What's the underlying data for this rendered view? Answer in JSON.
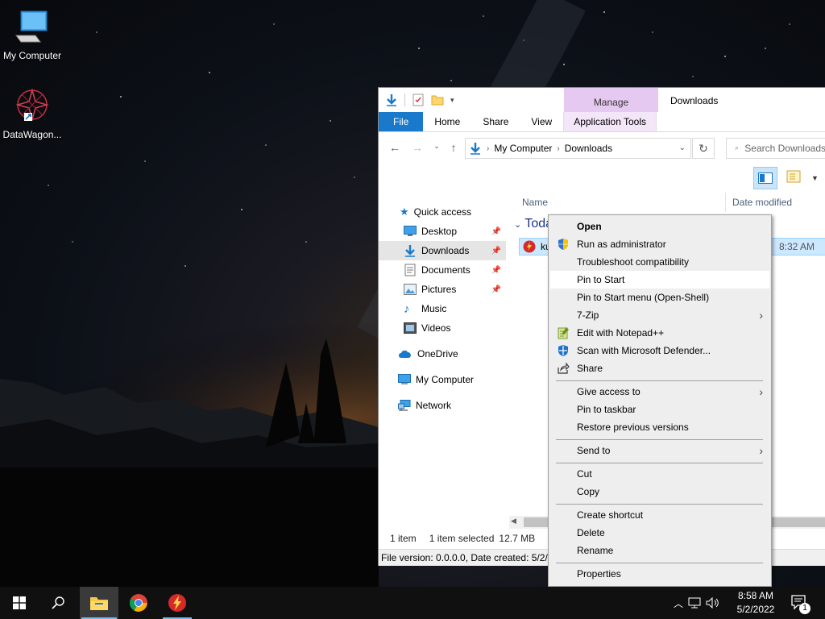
{
  "desktop": {
    "icons": [
      {
        "label": "My Computer",
        "icon": "monitor-icon"
      },
      {
        "label": "DataWagon...",
        "icon": "datawagon-app-icon"
      }
    ]
  },
  "explorer": {
    "window_title": "Downloads",
    "contextual_tab_header": "Manage",
    "ribbon_tabs": [
      "File",
      "Home",
      "Share",
      "View",
      "Application Tools"
    ],
    "address": {
      "crumbs": [
        "My Computer",
        "Downloads"
      ]
    },
    "search_placeholder": "Search Downloads",
    "nav_pane": {
      "items": [
        {
          "label": "Quick access",
          "icon": "star-icon"
        },
        {
          "label": "Desktop",
          "icon": "desktop-folder-icon",
          "pinned": true
        },
        {
          "label": "Downloads",
          "icon": "download-arrow-icon",
          "pinned": true,
          "selected": true
        },
        {
          "label": "Documents",
          "icon": "documents-icon",
          "pinned": true
        },
        {
          "label": "Pictures",
          "icon": "pictures-icon",
          "pinned": true
        },
        {
          "label": "Music",
          "icon": "music-note-icon"
        },
        {
          "label": "Videos",
          "icon": "videos-icon"
        },
        {
          "label": "OneDrive",
          "icon": "cloud-icon"
        },
        {
          "label": "My Computer",
          "icon": "computer-icon"
        },
        {
          "label": "Network",
          "icon": "network-icon"
        }
      ]
    },
    "columns": {
      "name": "Name",
      "date_modified": "Date modified"
    },
    "group_header": "Toda",
    "file_row": {
      "name": "ku",
      "date": "8:32 AM"
    },
    "status": {
      "item_count": "1 item",
      "selected": "1 item selected",
      "size": "12.7 MB"
    },
    "details_bar": "File version: 0.0.0.0, Date created: 5/2/20"
  },
  "context_menu": {
    "items": [
      {
        "label": "Open",
        "bold": true
      },
      {
        "label": "Run as administrator",
        "icon": "uac-shield-icon"
      },
      {
        "label": "Troubleshoot compatibility"
      },
      {
        "label": "Pin to Start",
        "hover": true
      },
      {
        "label": "Pin to Start menu (Open-Shell)"
      },
      {
        "label": "7-Zip",
        "submenu": true
      },
      {
        "label": "Edit with Notepad++",
        "icon": "notepadpp-icon"
      },
      {
        "label": "Scan with Microsoft Defender...",
        "icon": "defender-icon"
      },
      {
        "label": "Share",
        "icon": "share-icon"
      },
      {
        "label": "Give access to",
        "submenu": true
      },
      {
        "label": "Pin to taskbar"
      },
      {
        "label": "Restore previous versions"
      },
      {
        "label": "Send to",
        "submenu": true
      },
      {
        "label": "Cut"
      },
      {
        "label": "Copy"
      },
      {
        "label": "Create shortcut"
      },
      {
        "label": "Delete"
      },
      {
        "label": "Rename"
      },
      {
        "label": "Properties"
      }
    ]
  },
  "taskbar": {
    "apps": [
      "start-icon",
      "search-icon",
      "file-explorer-icon",
      "chrome-icon",
      "app-red-icon"
    ],
    "clock": {
      "time": "8:58 AM",
      "date": "5/2/2022"
    },
    "notification_count": "1"
  },
  "colors": {
    "accent": "#1979ca",
    "manage_tab": "#e6c9f0",
    "selection": "#cce8ff",
    "taskbar": "#101010"
  }
}
